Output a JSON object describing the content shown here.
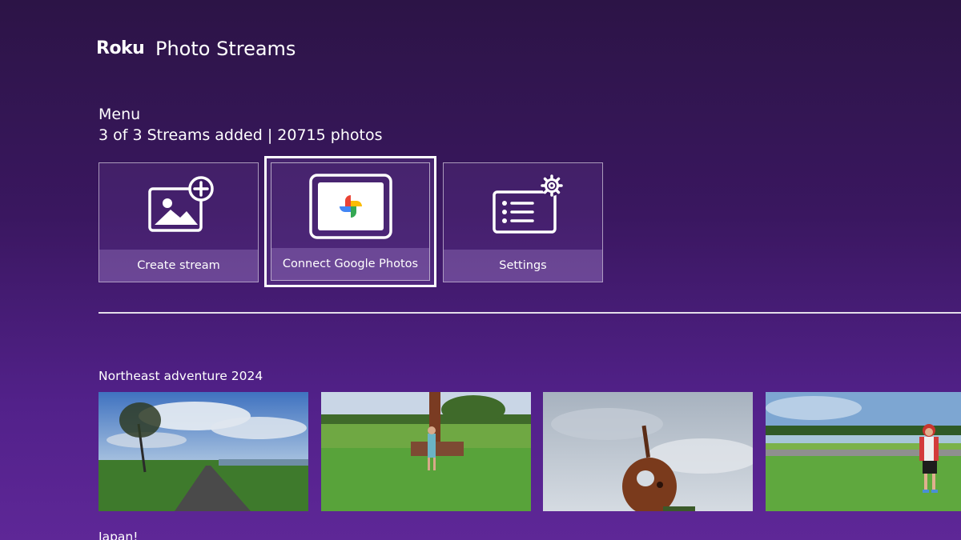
{
  "header": {
    "brand": "Roku",
    "title": "Photo Streams"
  },
  "menu": {
    "label": "Menu",
    "status": "3 of 3 Streams added | 20715 photos",
    "tiles": [
      {
        "label": "Create stream",
        "icon": "add-image-icon"
      },
      {
        "label": "Connect Google Photos",
        "icon": "google-photos-icon",
        "focused": true
      },
      {
        "label": "Settings",
        "icon": "settings-list-icon"
      }
    ]
  },
  "streams": [
    {
      "title": "Northeast adventure 2024",
      "photos": [
        "path-under-cloudy-sky-photo",
        "statue-in-grass-field-photo",
        "rusty-sculpture-photo",
        "child-in-park-photo"
      ]
    },
    {
      "title": "Japan!"
    }
  ],
  "colors": {
    "background_top": "#2c1446",
    "background_bottom": "#5e2797",
    "accent": "#ffffff"
  }
}
